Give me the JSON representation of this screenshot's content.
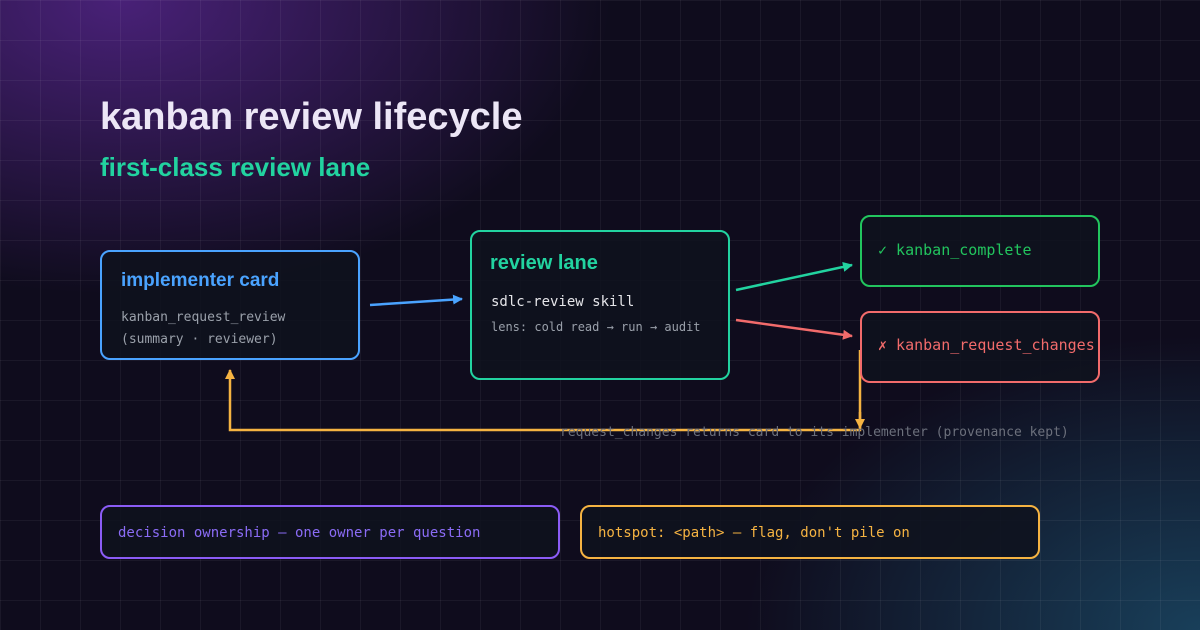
{
  "header": {
    "title": "kanban review lifecycle",
    "subtitle": "first-class review lane"
  },
  "nodes": {
    "implementer": {
      "title": "implementer card",
      "line1": "kanban_request_review",
      "line2": "(summary · reviewer)"
    },
    "review": {
      "title": "review lane",
      "line1": "sdlc-review skill",
      "line2": "lens: cold read → run → audit"
    },
    "complete": {
      "label": "✓ kanban_complete"
    },
    "changes": {
      "label": "✗ kanban_request_changes"
    }
  },
  "return_caption": "request_changes returns card to its implementer (provenance kept)",
  "notes": {
    "ownership": "decision ownership — one owner per question",
    "hotspot": "hotspot: <path> — flag, don't pile on"
  },
  "colors": {
    "implementer": "#4aa3ff",
    "review": "#22d3a0",
    "complete": "#22c55e",
    "changes": "#f26b6b",
    "return": "#f5b342",
    "ownership": "#8b5cf6"
  },
  "icons": {
    "complete": "check-icon",
    "changes": "cross-icon"
  }
}
